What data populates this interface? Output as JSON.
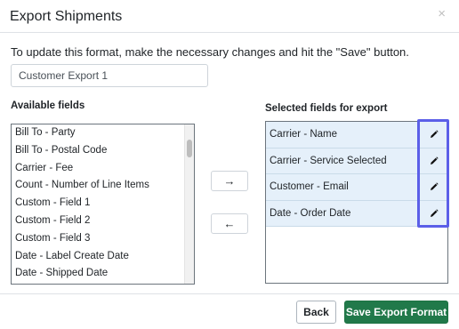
{
  "modal": {
    "title": "Export Shipments",
    "close_icon": "close-icon",
    "close_glyph": "×"
  },
  "instructions": "To update this format, make the necessary changes and hit the \"Save\" button.",
  "format_name": {
    "value": "Customer Export 1"
  },
  "available": {
    "label": "Available fields",
    "items": [
      "Bill To - Party",
      "Bill To - Postal Code",
      "Carrier - Fee",
      "Count - Number of Line Items",
      "Custom - Field 1",
      "Custom - Field 2",
      "Custom - Field 3",
      "Date - Label Create Date",
      "Date - Shipped Date"
    ]
  },
  "move_buttons": {
    "right_icon": "arrow-right-icon",
    "right_glyph": "→",
    "left_icon": "arrow-left-icon",
    "left_glyph": "←"
  },
  "selected": {
    "label": "Selected fields for export",
    "items": [
      "Carrier - Name",
      "Carrier - Service Selected",
      "Customer - Email",
      "Date - Order Date"
    ],
    "edit_icon": "pencil-icon"
  },
  "footer": {
    "back_label": "Back",
    "save_label": "Save Export Format"
  },
  "colors": {
    "save_button": "#21794a",
    "selected_row": "#e5f0fa",
    "highlight": "#5b5fe8"
  }
}
